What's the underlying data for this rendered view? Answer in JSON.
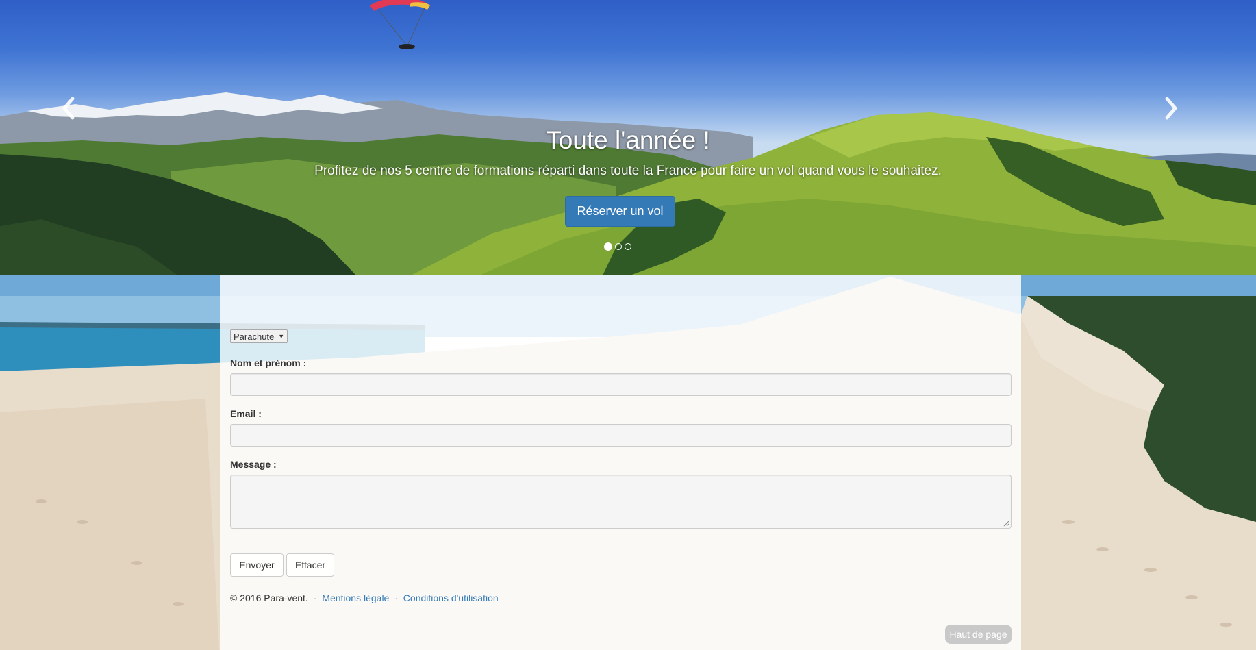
{
  "carousel": {
    "title": "Toute l'année !",
    "text": "Profitez de nos 5 centre de formations réparti dans toute la France pour faire un vol quand vous le souhaitez.",
    "cta_label": "Réserver un vol",
    "prev_icon": "chevron-left-icon",
    "next_icon": "chevron-right-icon",
    "active_slide": 1,
    "slide_count": 3
  },
  "form": {
    "select_value": "Parachute",
    "name_label": "Nom et prénom :",
    "name_value": "",
    "email_label": "Email :",
    "email_value": "",
    "message_label": "Message :",
    "message_value": "",
    "submit_label": "Envoyer",
    "reset_label": "Effacer"
  },
  "footer": {
    "copyright": "© 2016 Para-vent.",
    "legal_link": "Mentions légale",
    "terms_link": "Conditions d'utilisation",
    "back_to_top": "Haut de page"
  },
  "colors": {
    "primary": "#337ab7",
    "link": "#337ab7",
    "panel": "#ffffff"
  }
}
